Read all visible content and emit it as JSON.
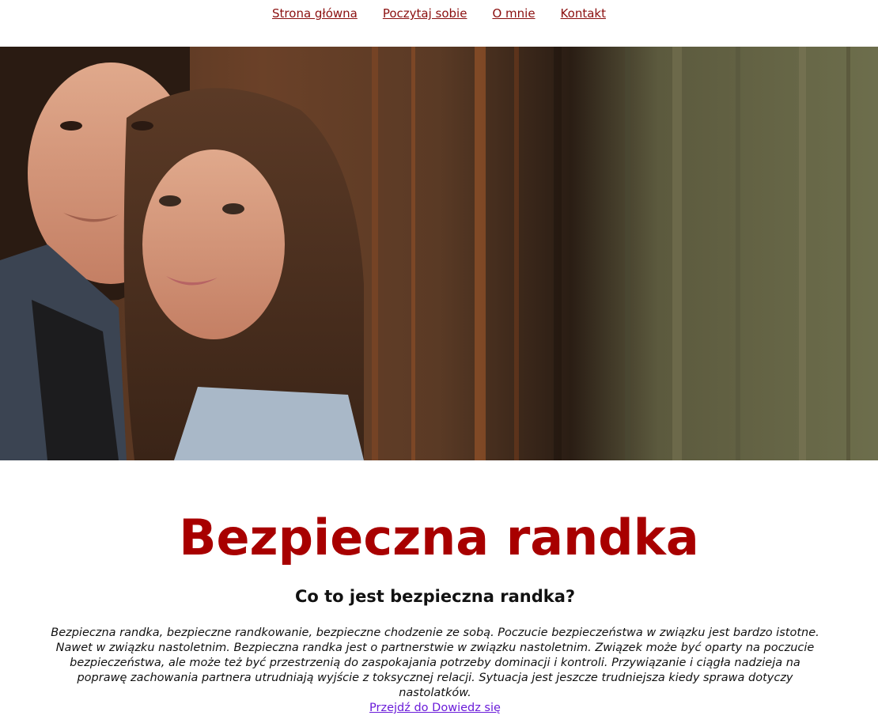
{
  "nav": {
    "items": [
      {
        "label": "Strona główna"
      },
      {
        "label": "Poczytaj sobie"
      },
      {
        "label": "O mnie"
      },
      {
        "label": "Kontakt"
      }
    ]
  },
  "hero": {
    "image_icon": "couple-photo"
  },
  "main": {
    "title": "Bezpieczna randka",
    "subtitle": "Co to jest bezpieczna randka?",
    "paragraph": "Bezpieczna randka, bezpieczne randkowanie, bezpieczne chodzenie ze sobą. Poczucie bezpieczeństwa w związku jest bardzo istotne. Nawet w związku nastoletnim. Bezpieczna randka jest o partnerstwie w związku nastoletnim. Związek może być oparty na poczucie bezpieczeństwa, ale może też być przestrzenią do zaspokajania potrzeby dominacji i kontroli. Przywiązanie i ciągła nadzieja na poprawę zachowania partnera utrudniają wyjście z toksycznej relacji. Sytuacja jest jeszcze trudniejsza kiedy sprawa dotyczy nastolatków.",
    "link_label": "Przejdź do Dowiedz się"
  },
  "colors": {
    "nav_link": "#8b0f0f",
    "title": "#a80000",
    "link": "#6a1bd9"
  }
}
